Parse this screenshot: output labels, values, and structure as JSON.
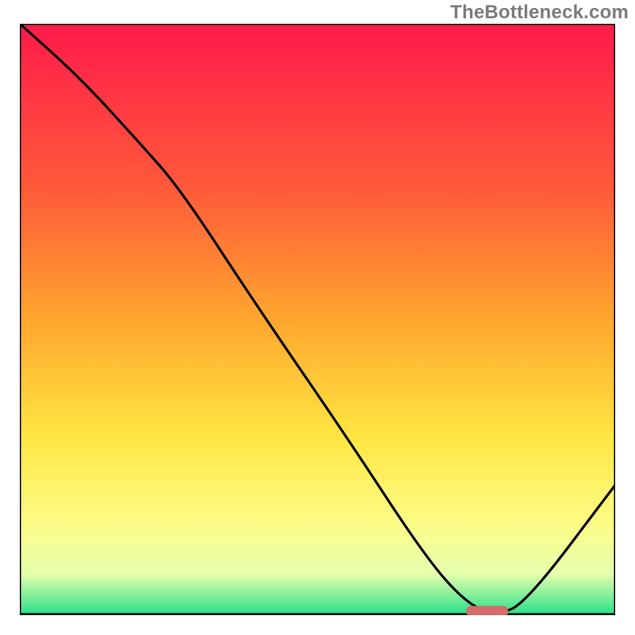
{
  "watermark": "TheBottleneck.com",
  "chart_data": {
    "type": "line",
    "title": "",
    "xlabel": "",
    "ylabel": "",
    "xlim": [
      0,
      100
    ],
    "ylim": [
      0,
      100
    ],
    "grid": false,
    "legend": false,
    "background_gradient_stops": [
      {
        "pct": 0,
        "color": "#ff1a4b"
      },
      {
        "pct": 28,
        "color": "#ff5a3a"
      },
      {
        "pct": 50,
        "color": "#ffa62e"
      },
      {
        "pct": 70,
        "color": "#ffe642"
      },
      {
        "pct": 85,
        "color": "#fdfd8a"
      },
      {
        "pct": 93,
        "color": "#e6ffad"
      },
      {
        "pct": 100,
        "color": "#26e08a"
      }
    ],
    "series": [
      {
        "name": "bottleneck-curve",
        "x": [
          0,
          10,
          20,
          27,
          40,
          55,
          68,
          75,
          80,
          85,
          100
        ],
        "values": [
          100,
          91,
          80,
          72,
          52,
          30,
          10,
          2,
          0,
          2,
          22
        ]
      }
    ],
    "marker": {
      "name": "optimal-segment",
      "x_start": 75,
      "x_end": 82,
      "y": 0.5,
      "color": "#d46a6a"
    }
  }
}
